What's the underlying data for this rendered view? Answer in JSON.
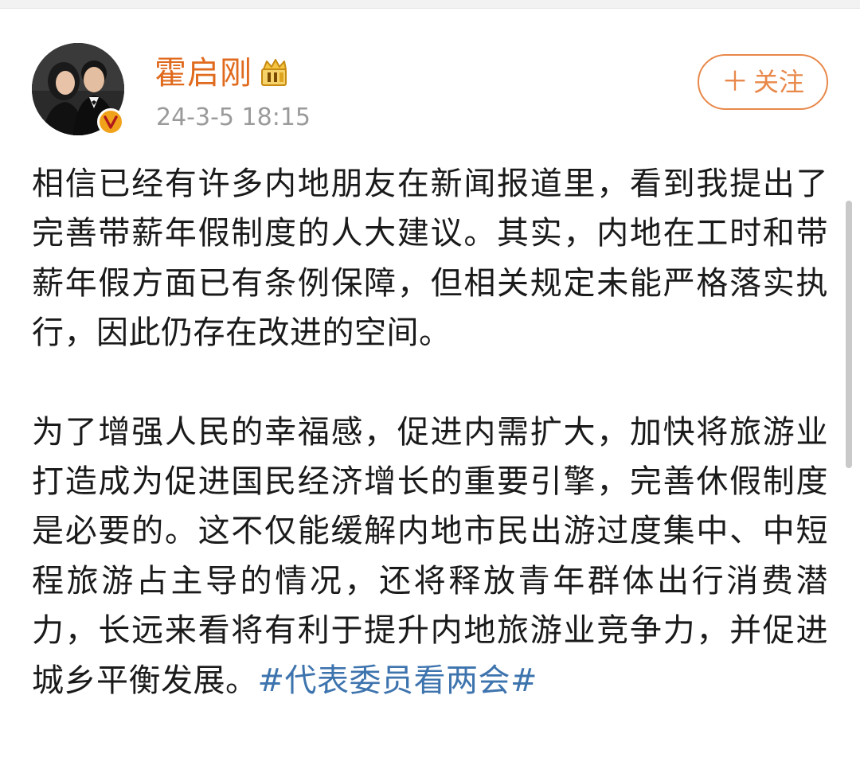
{
  "post": {
    "author": {
      "name": "霍启刚",
      "avatar_icon": "couple-portrait-avatar",
      "verified_badge_icon": "verified-v-badge-icon",
      "rank_icon": "crown-rank-icon"
    },
    "timestamp": "24-3-5 18:15",
    "follow_button": {
      "plus": "＋",
      "label": "关注"
    },
    "paragraphs": [
      {
        "text": "相信已经有许多内地朋友在新闻报道里，看到我提出了完善带薪年假制度的人大建议。其实，内地在工时和带薪年假方面已有条例保障，但相关规定未能严格落实执行，因此仍存在改进的空间。",
        "hashtag": ""
      },
      {
        "text": "为了增强人民的幸福感，促进内需扩大，加快将旅游业打造成为促进国民经济增长的重要引擎，完善休假制度是必要的。这不仅能缓解内地市民出游过度集中、中短程旅游占主导的情况，还将释放青年群体出行消费潜力，长远来看将有利于提升内地旅游业竞争力，并促进城乡平衡发展。",
        "hashtag": "#代表委员看两会#"
      }
    ]
  },
  "colors": {
    "username": "#e06a1d",
    "follow_border": "#e8884a",
    "hashtag": "#3e74ae",
    "body_text": "#1a1a1a",
    "timestamp": "#9a9a9a",
    "verified_badge": "#f1a21b"
  }
}
